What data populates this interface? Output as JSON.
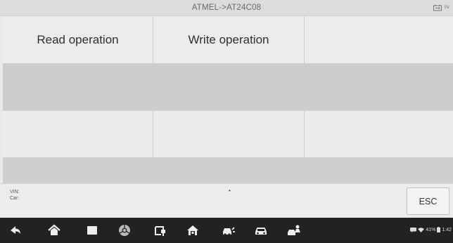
{
  "titlebar": {
    "title": "ATMEL->AT24C08",
    "battery_icon": "battery-icon",
    "voltage": "0V"
  },
  "grid": {
    "rows": [
      [
        "Read operation",
        "Write operation",
        ""
      ],
      [
        "",
        "",
        ""
      ],
      [
        "",
        "",
        ""
      ],
      [
        "",
        "",
        ""
      ]
    ]
  },
  "info": {
    "vin_label": "VIN:",
    "car_label": "Car:",
    "marker": "•",
    "esc_label": "ESC"
  },
  "navbar": {
    "icons": [
      "back-icon",
      "home-icon",
      "recent-apps-icon",
      "browser-icon",
      "vci-connect-icon",
      "home-diagnostics-icon",
      "vehicle-service-icon",
      "vehicle-icon",
      "shop-manager-icon"
    ],
    "battery_percent": "41%",
    "time": "1:42"
  },
  "colors": {
    "navbar_bg": "#222222",
    "row_light": "#ececec",
    "row_dark": "#cdcdcd"
  }
}
